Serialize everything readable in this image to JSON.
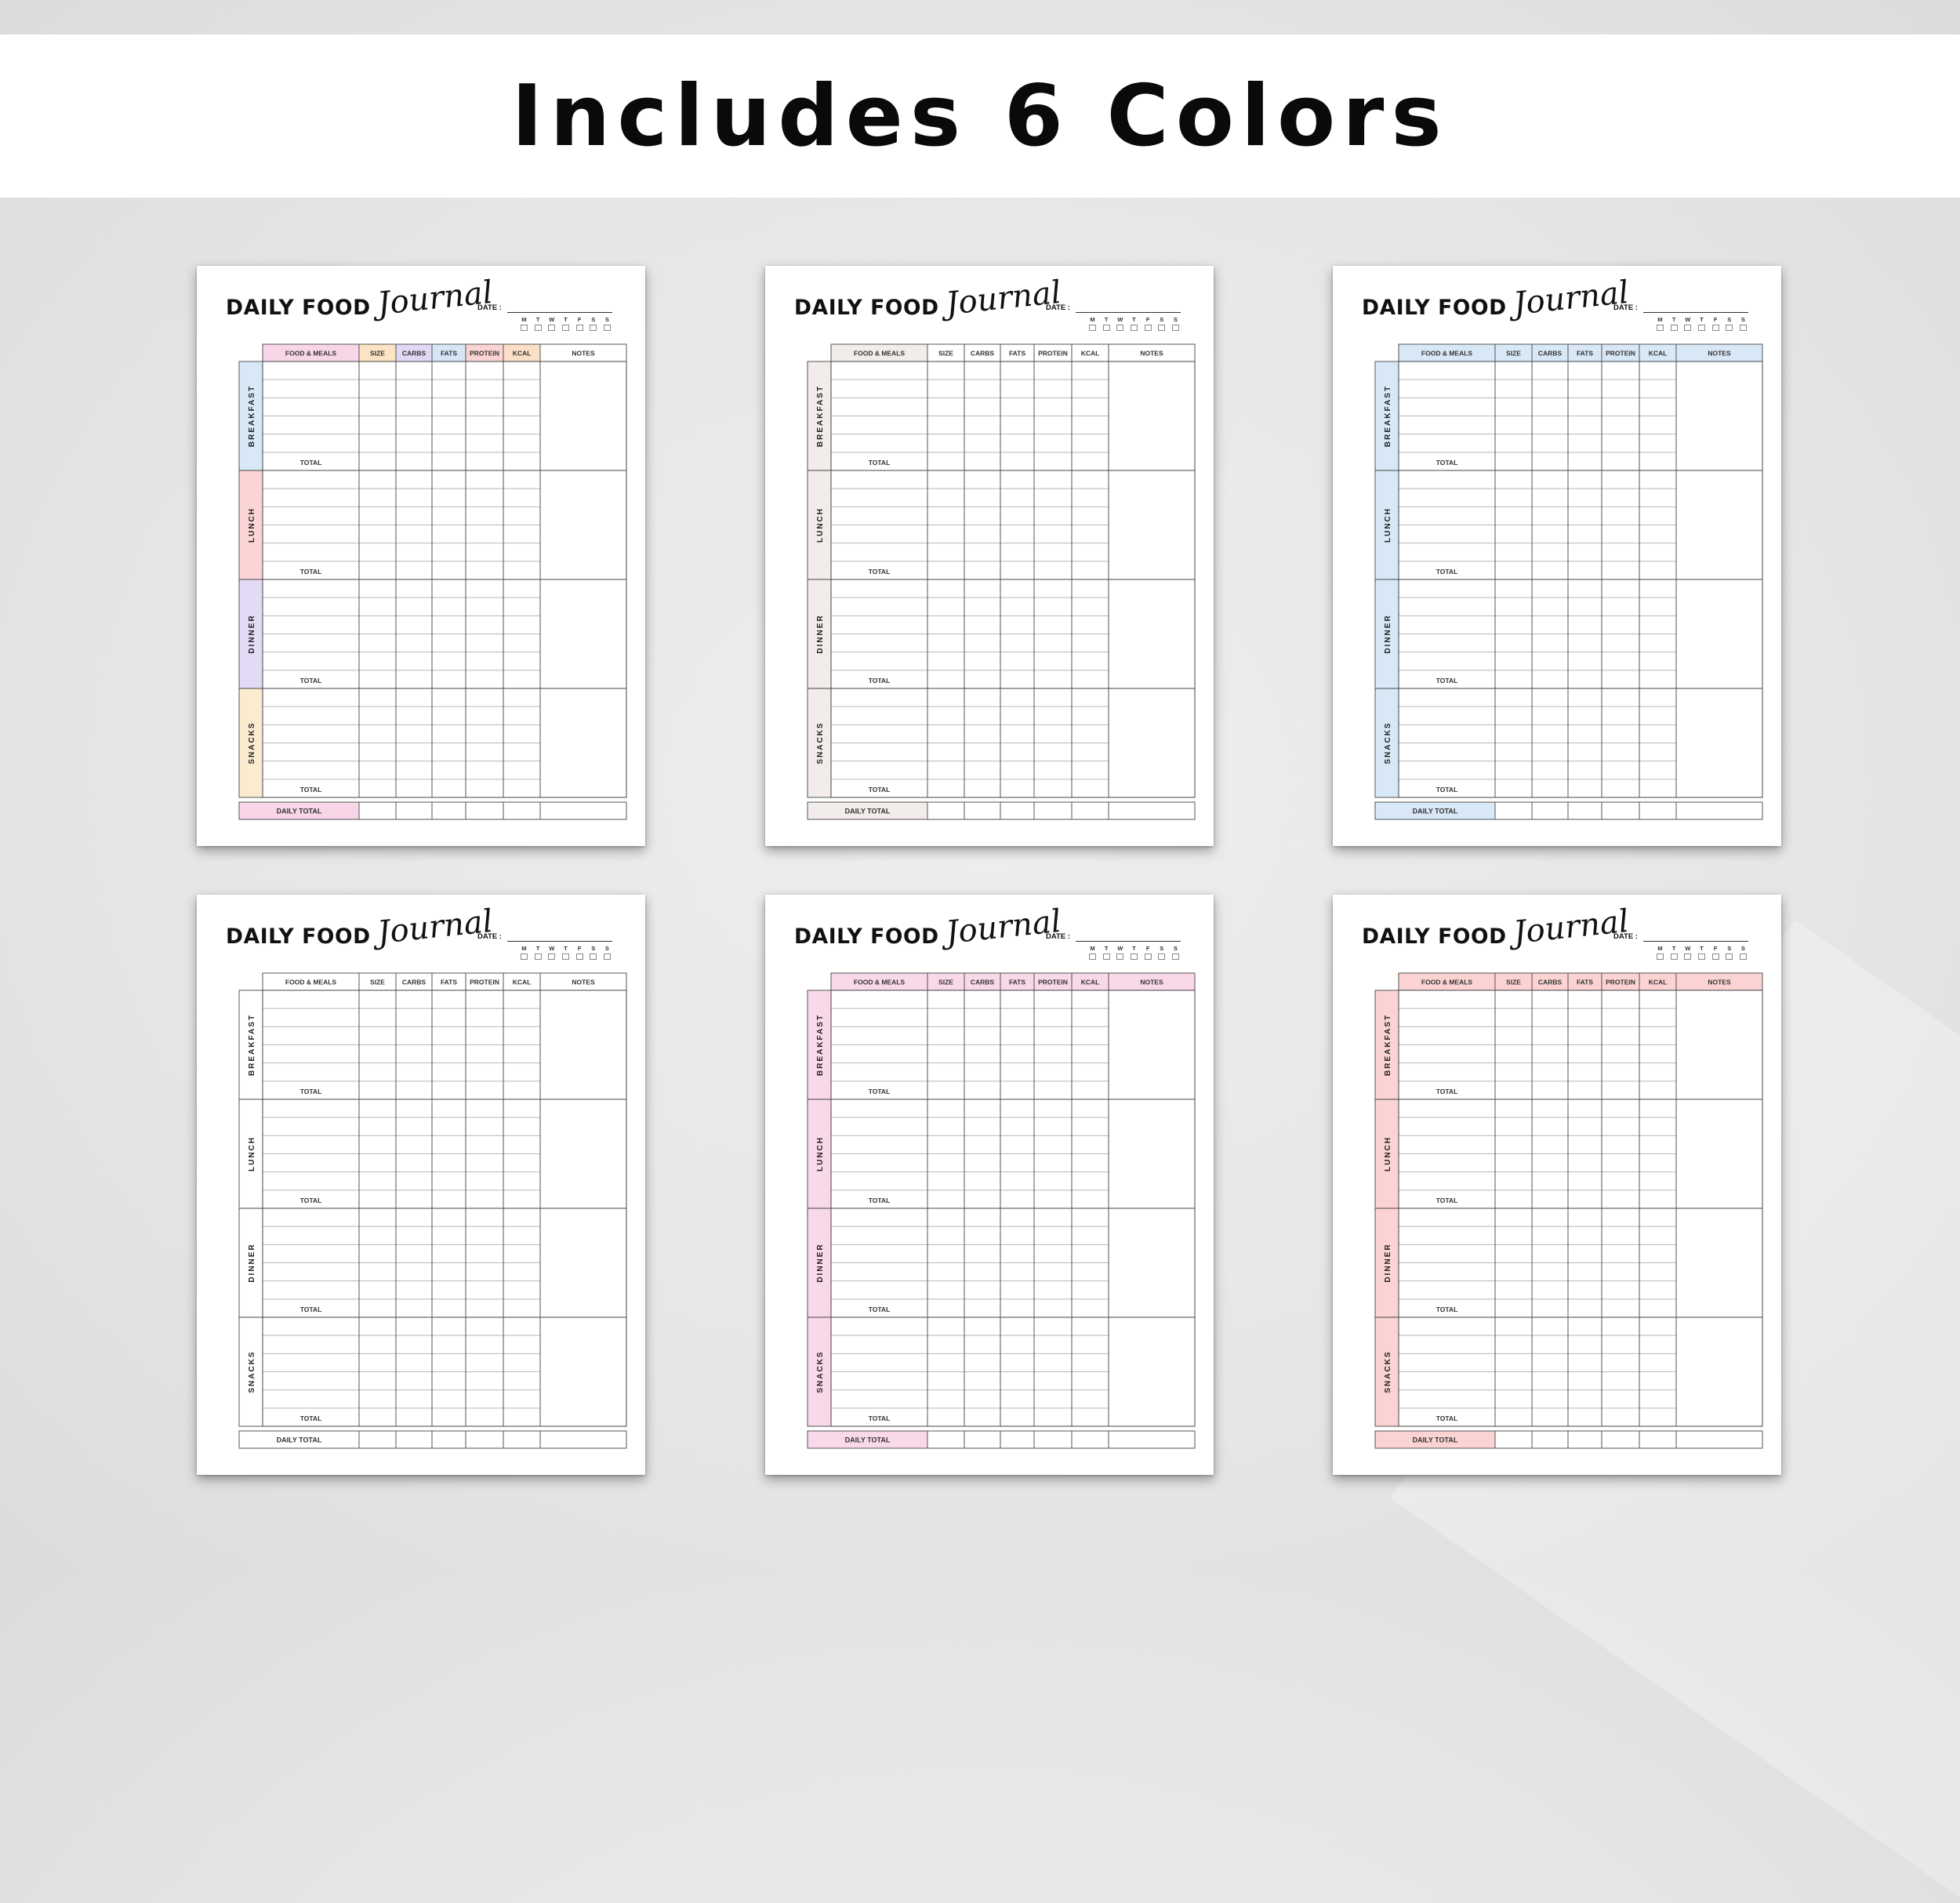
{
  "banner": {
    "title": "Includes 6 Colors"
  },
  "journal": {
    "title": "DAILY FOOD",
    "script": "Journal",
    "date_label": "DATE :",
    "days": [
      "M",
      "T",
      "W",
      "T",
      "F",
      "S",
      "S"
    ],
    "columns": [
      "FOOD & MEALS",
      "SIZE",
      "CARBS",
      "FATS",
      "PROTEIN",
      "KCAL",
      "NOTES"
    ],
    "sections": [
      "BREAKFAST",
      "LUNCH",
      "DINNER",
      "SNACKS"
    ],
    "total_label": "TOTAL",
    "daily_total_label": "DAILY TOTAL"
  },
  "variants": [
    {
      "name": "pastel",
      "columns": [
        "#f8d6e8",
        "#fbe3c4",
        "#e2d8f6",
        "#d7e6f7",
        "#fbd3d3",
        "#fbdfc6"
      ],
      "sections": [
        "#d9e8f7",
        "#fbd5d5",
        "#e3dbf6",
        "#fbeccf"
      ],
      "daily_total": "#f8d6e8"
    },
    {
      "name": "neutral",
      "columns": [
        "#f2ecea",
        "#ffffff",
        "#ffffff",
        "#ffffff",
        "#ffffff",
        "#ffffff",
        "#ffffff"
      ],
      "sections": [
        "#f2ecea",
        "#f2ecea",
        "#f2ecea",
        "#f2ecea"
      ],
      "daily_total": "#f2ecea"
    },
    {
      "name": "blue",
      "columns": [
        "#d9e8f7",
        "#d9e8f7",
        "#d9e8f7",
        "#d9e8f7",
        "#d9e8f7",
        "#d9e8f7",
        "#d9e8f7"
      ],
      "sections": [
        "#d9e8f7",
        "#d9e8f7",
        "#d9e8f7",
        "#d9e8f7"
      ],
      "daily_total": "#d9e8f7"
    },
    {
      "name": "white",
      "columns": [
        "#ffffff",
        "#ffffff",
        "#ffffff",
        "#ffffff",
        "#ffffff",
        "#ffffff",
        "#ffffff"
      ],
      "sections": [
        "#ffffff",
        "#ffffff",
        "#ffffff",
        "#ffffff"
      ],
      "daily_total": "#ffffff"
    },
    {
      "name": "pink",
      "columns": [
        "#f9d8ea",
        "#f9d8ea",
        "#f9d8ea",
        "#f9d8ea",
        "#f9d8ea",
        "#f9d8ea",
        "#f9d8ea"
      ],
      "sections": [
        "#f9d8ea",
        "#f9d8ea",
        "#f9d8ea",
        "#f9d8ea"
      ],
      "daily_total": "#f9d8ea"
    },
    {
      "name": "coral",
      "columns": [
        "#fbd3d3",
        "#fbd3d3",
        "#fbd3d3",
        "#fbd3d3",
        "#fbd3d3",
        "#fbd3d3",
        "#fbd3d3"
      ],
      "sections": [
        "#fbd3d3",
        "#fbd3d3",
        "#fbd3d3",
        "#fbd3d3"
      ],
      "daily_total": "#fbd3d3"
    }
  ]
}
